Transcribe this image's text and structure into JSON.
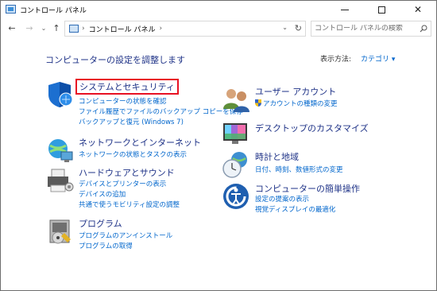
{
  "window": {
    "title": "コントロール パネル"
  },
  "navigation": {
    "address_path": "コントロール パネル",
    "search_placeholder": "コントロール パネルの検索"
  },
  "main": {
    "heading": "コンピューターの設定を調整します",
    "view_by_label": "表示方法:",
    "view_by_value": "カテゴリ ▾"
  },
  "categories": {
    "system_security": {
      "title": "システムとセキュリティ",
      "links": [
        "コンピューターの状態を確認",
        "ファイル履歴でファイルのバックアップ コピーを保存",
        "バックアップと復元 (Windows 7)"
      ]
    },
    "network": {
      "title": "ネットワークとインターネット",
      "links": [
        "ネットワークの状態とタスクの表示"
      ]
    },
    "hardware": {
      "title": "ハードウェアとサウンド",
      "links": [
        "デバイスとプリンターの表示",
        "デバイスの追加",
        "共通で使うモビリティ設定の調整"
      ]
    },
    "programs": {
      "title": "プログラム",
      "links": [
        "プログラムのアンインストール",
        "プログラムの取得"
      ]
    },
    "user_accounts": {
      "title": "ユーザー アカウント",
      "links": [
        "アカウントの種類の変更"
      ]
    },
    "personalization": {
      "title": "デスクトップのカスタマイズ",
      "links": []
    },
    "clock_region": {
      "title": "時計と地域",
      "links": [
        "日付、時刻、数値形式の変更"
      ]
    },
    "ease_of_access": {
      "title": "コンピューターの簡単操作",
      "links": [
        "設定の提案の表示",
        "視覚ディスプレイの最適化"
      ]
    }
  },
  "colors": {
    "heading": "#1e3287",
    "link": "#0066cc",
    "highlight_box": "#e81123"
  }
}
